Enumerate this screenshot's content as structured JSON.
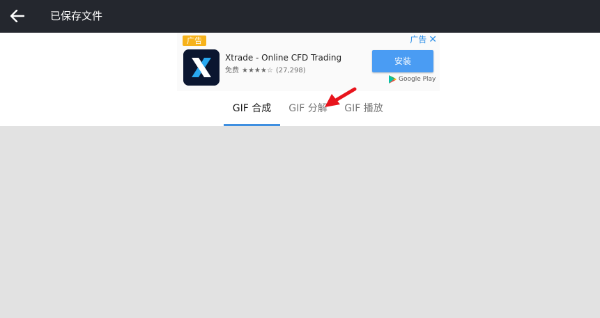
{
  "topbar": {
    "title": "已保存文件"
  },
  "ad": {
    "badge": "广告",
    "corner_label": "广告",
    "app_name": "Xtrade - Online CFD Trading",
    "price": "免费",
    "rating_stars": "★★★★☆",
    "rating_count": "(27,298)",
    "install_label": "安装",
    "store_label": "Google Play"
  },
  "tabs": [
    {
      "label": "GIF 合成",
      "active": true
    },
    {
      "label": "GIF 分解",
      "active": false
    },
    {
      "label": "GIF 播放",
      "active": false
    }
  ],
  "colors": {
    "topbar": "#24272e",
    "accent": "#3f8fe0",
    "install": "#4a9cf3",
    "ad_badge": "#f6b21b",
    "background": "#e2e2e2"
  }
}
